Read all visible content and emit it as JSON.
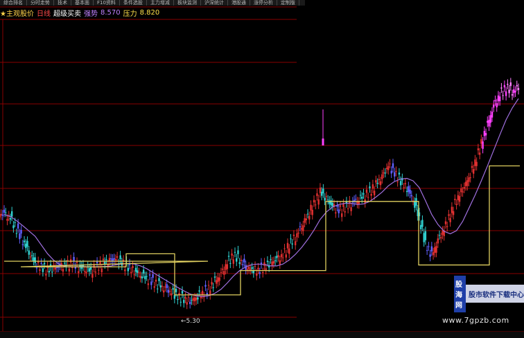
{
  "tabs": [
    "综合排名",
    "分时走势",
    "技术",
    "基本面",
    "F10资料",
    "条件选股",
    "主力增减",
    "板块监测",
    "沪深统计",
    "港股通",
    "涨停分析",
    "定制版"
  ],
  "header": {
    "title": "★主观股价",
    "line_label": "日线",
    "indicator": "超级买卖",
    "support_label": "强势",
    "support_value": "8.570",
    "pressure_label": "压力",
    "pressure_value": "8.820"
  },
  "low_marker": "←5.30",
  "logo": {
    "mark": "股海网",
    "text": "股市软件下载中心"
  },
  "watermark": "www.7gpzb.com",
  "colors": {
    "grid": "#8a0000",
    "ma": "#a070e0",
    "step": "#e0d060",
    "up": "#e03030",
    "down": "#30d0d0",
    "mid": "#6060ff",
    "hot": "#ff40ff"
  },
  "chart_data": {
    "type": "candlestick",
    "low_label_value": 5.3,
    "support": 8.57,
    "pressure": 8.82,
    "note": "",
    "closes": [
      7.6,
      7.5,
      7.2,
      6.9,
      6.6,
      6.3,
      6.2,
      6.1,
      6.15,
      6.2,
      6.25,
      6.3,
      6.2,
      6.15,
      6.1,
      6.2,
      6.3,
      6.35,
      6.4,
      6.3,
      6.2,
      6.1,
      6.0,
      5.9,
      5.8,
      5.7,
      5.6,
      5.5,
      5.4,
      5.35,
      5.3,
      5.4,
      5.5,
      5.6,
      5.8,
      6.0,
      6.3,
      6.5,
      6.4,
      6.2,
      6.15,
      6.1,
      6.2,
      6.3,
      6.4,
      6.5,
      6.8,
      7.0,
      7.3,
      7.6,
      7.9,
      8.2,
      8.0,
      7.8,
      7.7,
      7.8,
      7.9,
      8.0,
      8.1,
      8.2,
      8.4,
      8.6,
      8.9,
      8.7,
      8.5,
      8.3,
      8.0,
      7.5,
      6.8,
      6.5,
      6.9,
      7.2,
      7.6,
      8.0,
      8.3,
      8.6,
      9.0,
      9.5,
      10.0,
      10.5,
      10.8,
      11.0,
      10.9,
      11.0
    ]
  }
}
